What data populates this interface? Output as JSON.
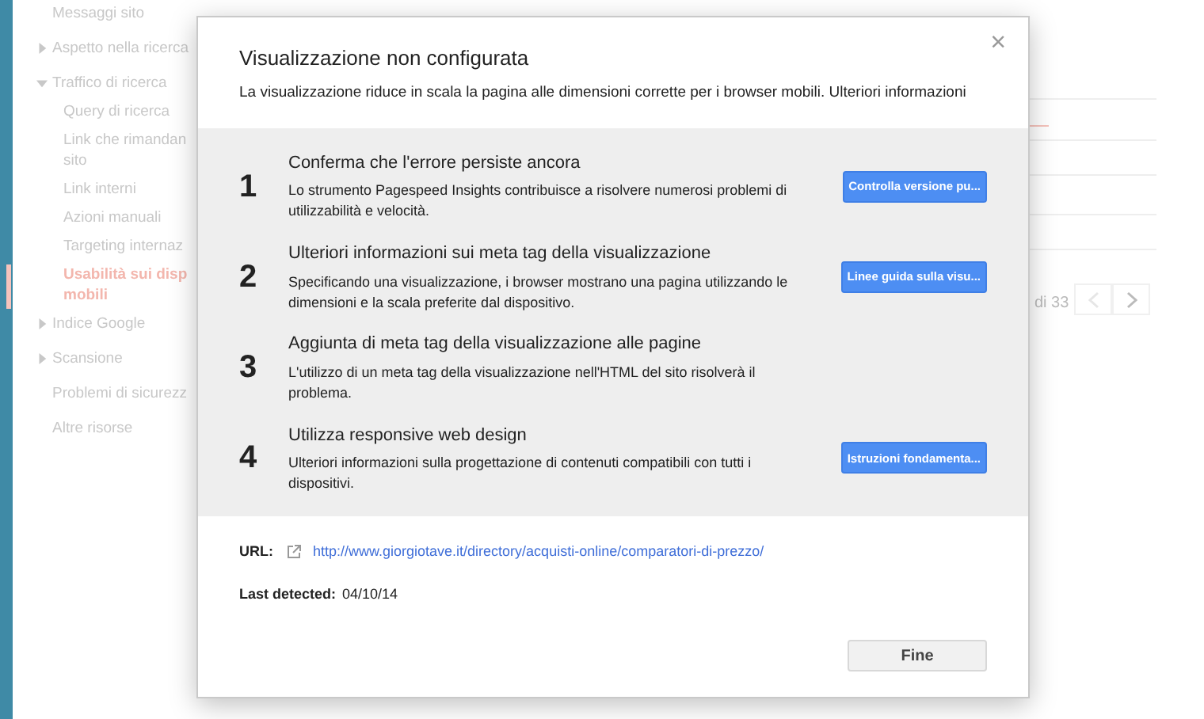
{
  "sidebar": {
    "items": [
      {
        "label": "Messaggi sito",
        "selected": false
      },
      {
        "label": "Aspetto nella ricerca",
        "expanded": false,
        "selected": false
      },
      {
        "label": "Traffico di ricerca",
        "expanded": true,
        "selected": false,
        "children": [
          {
            "label": "Query di ricerca",
            "selected": false
          },
          {
            "label": "Link che rimandan\nsito",
            "selected": false
          },
          {
            "label": "Link interni",
            "selected": false
          },
          {
            "label": "Azioni manuali",
            "selected": false
          },
          {
            "label": "Targeting internaz",
            "selected": false
          },
          {
            "label": "Usabilità sui disp\nmobili",
            "selected": true
          }
        ]
      },
      {
        "label": "Indice Google",
        "expanded": false,
        "selected": false
      },
      {
        "label": "Scansione",
        "expanded": false,
        "selected": false
      },
      {
        "label": "Problemi di sicurezz",
        "selected": false
      },
      {
        "label": "Altre risorse",
        "selected": false
      }
    ]
  },
  "pager": {
    "count": "di 33"
  },
  "dialog": {
    "title": "Visualizzazione non configurata",
    "description": "La visualizzazione riduce in scala la pagina alle dimensioni corrette per i browser mobili.",
    "link": "Ulteriori informazioni",
    "close": "×",
    "steps": [
      {
        "number": "1",
        "title": "Conferma che l'errore persiste ancora",
        "description": "Lo strumento Pagespeed Insights contribuisce a risolvere numerosi problemi di utilizzabilità e velocità.",
        "button": "Controlla versione pu..."
      },
      {
        "number": "2",
        "title": "Ulteriori informazioni sui meta tag della visualizzazione",
        "description": "Specificando una visualizzazione, i browser mostrano una pagina utilizzando le dimensioni e la scala preferite dal dispositivo.",
        "button": "Linee guida sulla visu..."
      },
      {
        "number": "3",
        "title": "Aggiunta di meta tag della visualizzazione alle pagine",
        "description": "L'utilizzo di un meta tag della visualizzazione nell'HTML del sito risolverà il problema."
      },
      {
        "number": "4",
        "title": "Utilizza responsive web design",
        "description": "Ulteriori informazioni sulla progettazione di contenuti compatibili con tutti i dispositivi.",
        "button": "Istruzioni fondamenta..."
      }
    ],
    "url_label": "URL:",
    "url": "http://www.giorgiotave.it/directory/acquisti-online/comparatori-di-prezzo/",
    "detected_label": "Last detected:",
    "detected": "04/10/14",
    "done_button": "Fine"
  }
}
